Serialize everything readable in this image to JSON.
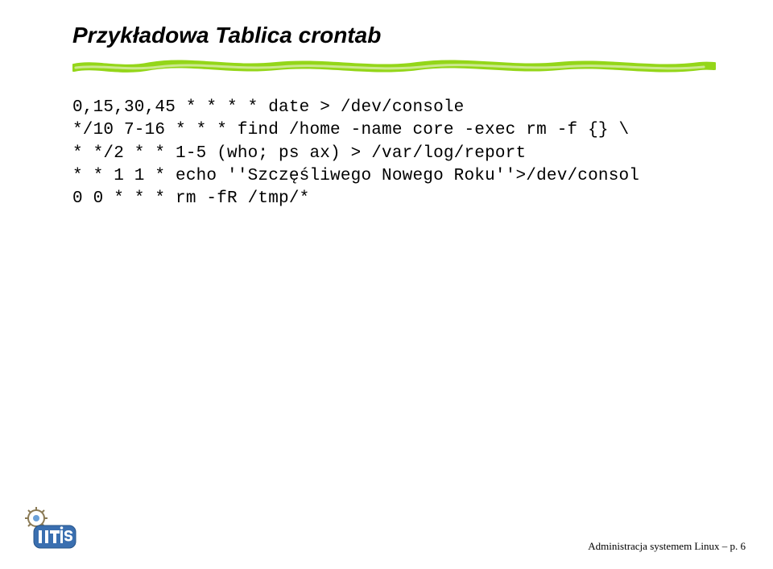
{
  "slide": {
    "title": "Przykładowa Tablica crontab",
    "code": {
      "line1": "0,15,30,45 * * * * date > /dev/console",
      "line2": "*/10 7-16 * * * find /home -name core -exec rm -f {} \\",
      "line3": "* */2 * * 1-5 (who; ps ax) > /var/log/report",
      "line4": "* * 1 1 * echo ''Szczęśliwego Nowego Roku''>/dev/consol",
      "line5": "0 0 * * * rm -fR /tmp/*"
    },
    "footer": {
      "text": "Administracja systemem Linux – p. 6"
    },
    "accent_color": "#94d619"
  }
}
